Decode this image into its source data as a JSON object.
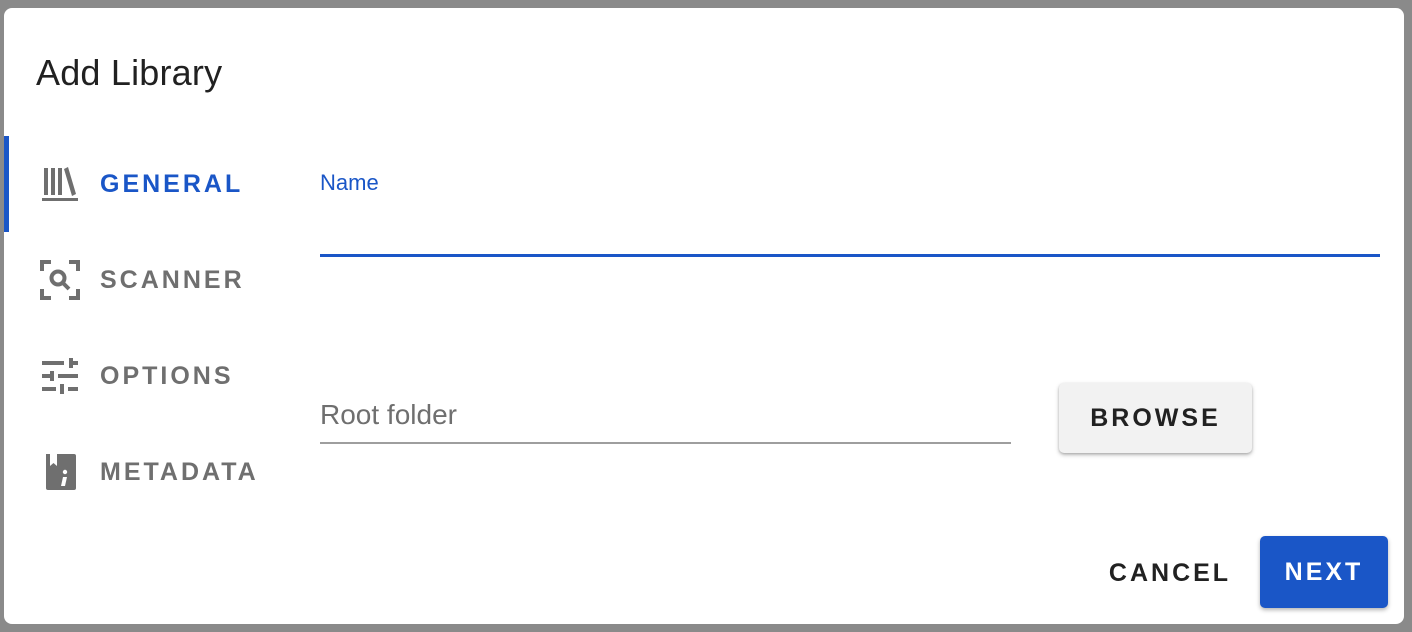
{
  "dialog": {
    "title": "Add Library"
  },
  "tabs": [
    {
      "label": "GENERAL",
      "icon": "library-books-icon",
      "active": true
    },
    {
      "label": "SCANNER",
      "icon": "scan-search-icon",
      "active": false
    },
    {
      "label": "OPTIONS",
      "icon": "tune-sliders-icon",
      "active": false
    },
    {
      "label": "METADATA",
      "icon": "book-info-icon",
      "active": false
    }
  ],
  "form": {
    "name_label": "Name",
    "name_value": "",
    "root_folder_placeholder": "Root folder",
    "root_folder_value": "",
    "browse_label": "BROWSE"
  },
  "actions": {
    "cancel_label": "CANCEL",
    "next_label": "NEXT"
  },
  "colors": {
    "accent": "#1a56c7",
    "inactive_text": "#6f6f6f",
    "text": "#212121",
    "backdrop": "#8a8a8a"
  }
}
